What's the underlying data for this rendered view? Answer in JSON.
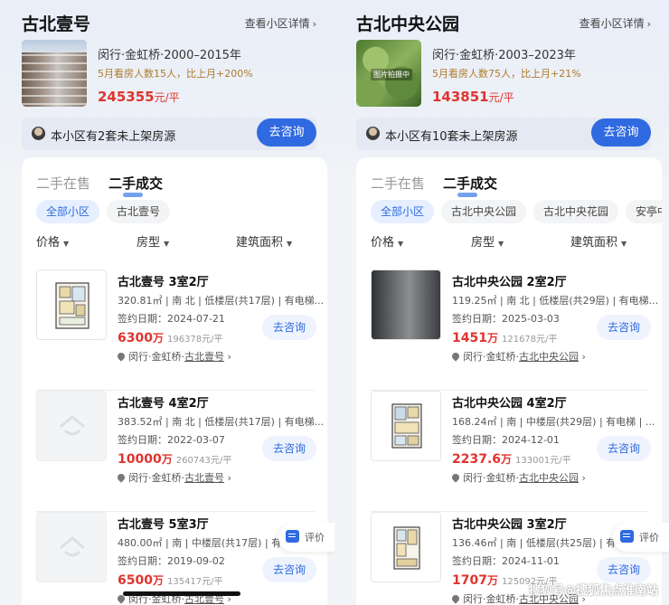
{
  "watermark": "搜狐号@搜狐焦点淮南站",
  "communities": [
    {
      "name": "古北壹号",
      "detail_link": "查看小区详情",
      "meta": "闵行·金虹桥·2000–2015年",
      "watch": "5月看房人数15人，比上月+200%",
      "price_value": "245355",
      "price_unit": "元/平",
      "notice": "本小区有2套未上架房源",
      "consult_label": "去咨询",
      "tabs": [
        "二手在售",
        "二手成交"
      ],
      "chips": [
        "全部小区",
        "古北壹号"
      ],
      "filters": [
        "价格",
        "房型",
        "建筑面积"
      ],
      "listings": [
        {
          "title": "古北壹号 3室2厅",
          "detail": "320.81㎡ | 南 北 | 低楼层(共17层) | 有电梯...",
          "date": "签约日期：2024-07-21",
          "price": "6300",
          "price_unit": "万",
          "per": "196378元/平",
          "loc_prefix": "闵行·金虹桥·",
          "loc_name": "古北壹号",
          "consult": "去咨询",
          "thumb": "floorplan"
        },
        {
          "title": "古北壹号 4室2厅",
          "detail": "383.52㎡ | 南 北 | 低楼层(共17层) | 有电梯...",
          "date": "签约日期：2022-03-07",
          "price": "10000",
          "price_unit": "万",
          "per": "260743元/平",
          "loc_prefix": "闵行·金虹桥·",
          "loc_name": "古北壹号",
          "consult": "去咨询",
          "thumb": "placeholder"
        },
        {
          "title": "古北壹号 5室3厅",
          "detail": "480.00㎡ | 南 | 中楼层(共17层) | 有电",
          "date": "签约日期：2019-09-02",
          "price": "6500",
          "price_unit": "万",
          "per": "135417元/平",
          "loc_prefix": "闵行·金虹桥·",
          "loc_name": "古北壹号",
          "consult": "去咨询",
          "thumb": "placeholder"
        }
      ],
      "eval_label": "评价"
    },
    {
      "name": "古北中央公园",
      "detail_link": "查看小区详情",
      "meta": "闵行·金虹桥·2003–2023年",
      "watch": "5月看房人数75人，比上月+21%",
      "price_value": "143851",
      "price_unit": "元/平",
      "thumb_tag": "图片拍摄中",
      "notice": "本小区有10套未上架房源",
      "consult_label": "去咨询",
      "tabs": [
        "二手在售",
        "二手成交"
      ],
      "chips": [
        "全部小区",
        "古北中央公园",
        "古北中央花园",
        "安亭中央公"
      ],
      "filters": [
        "价格",
        "房型",
        "建筑面积"
      ],
      "listings": [
        {
          "title": "古北中央公园 2室2厅",
          "detail": "119.25㎡ | 南 北 | 低楼层(共29层) | 有电梯...",
          "date": "签约日期：2025-03-03",
          "price": "1451",
          "price_unit": "万",
          "per": "121678元/平",
          "loc_prefix": "闵行·金虹桥·",
          "loc_name": "古北中央公园",
          "consult": "去咨询",
          "thumb": "photo"
        },
        {
          "title": "古北中央公园 4室2厅",
          "detail": "168.24㎡ | 南 | 中楼层(共29层) | 有电梯 | ...",
          "date": "签约日期：2024-12-01",
          "price": "2237.6",
          "price_unit": "万",
          "per": "133001元/平",
          "loc_prefix": "闵行·金虹桥·",
          "loc_name": "古北中央公园",
          "consult": "去咨询",
          "thumb": "floorplan"
        },
        {
          "title": "古北中央公园 3室2厅",
          "detail": "136.46㎡ | 南 | 低楼层(共25层) | 有电",
          "date": "签约日期：2024-11-01",
          "price": "1707",
          "price_unit": "万",
          "per": "125092元/平",
          "loc_prefix": "闵行·金虹桥·",
          "loc_name": "古北中央公园",
          "consult": "去咨询",
          "thumb": "floorplan"
        }
      ],
      "eval_label": "评价"
    }
  ],
  "colors": {
    "accent": "#2f6ae0",
    "price": "#e0342e",
    "watch": "#b07a2a"
  },
  "icons": [
    "chevron-right-icon",
    "avatar-icon",
    "caret-down-icon",
    "location-pin-icon",
    "house-placeholder-icon",
    "comment-icon"
  ]
}
